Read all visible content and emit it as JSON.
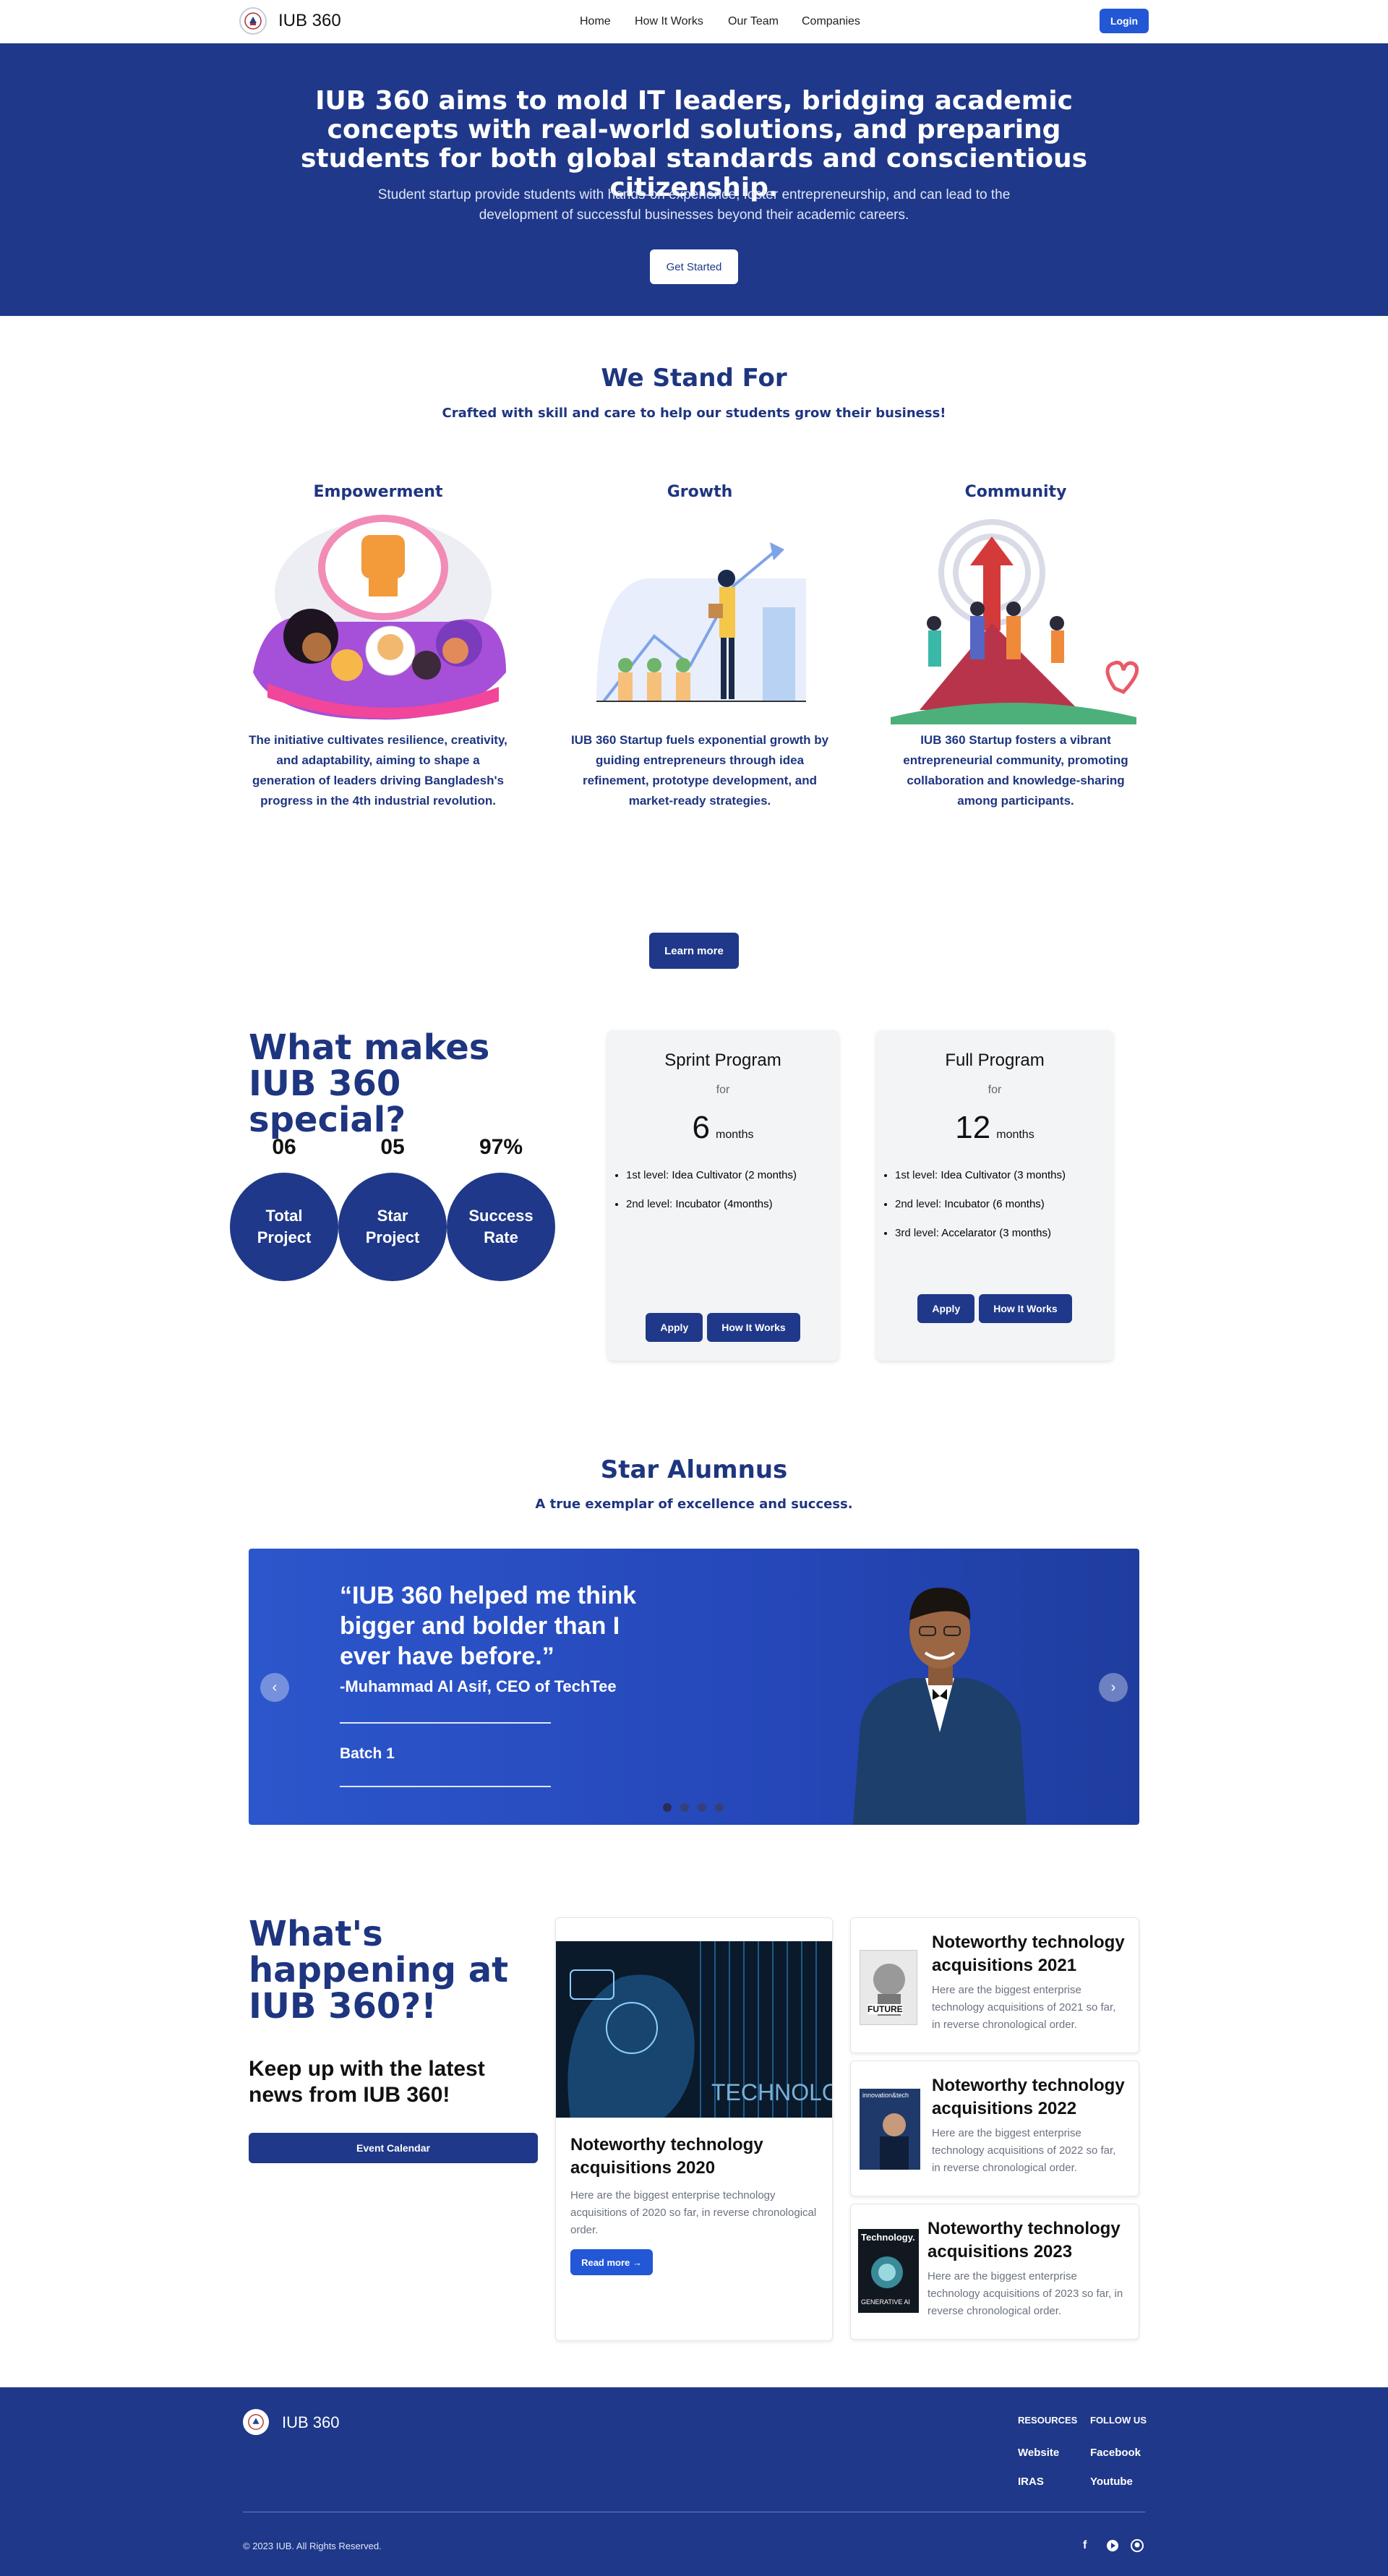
{
  "header": {
    "brand": "IUB 360",
    "nav": [
      "Home",
      "How It Works",
      "Our Team",
      "Companies"
    ],
    "login": "Login"
  },
  "hero": {
    "title": "IUB 360 aims to mold IT leaders, bridging academic concepts with real-world solutions, and preparing students for both global standards and conscientious citizenship.",
    "subtitle": "Student startup provide students with hands-on experience, foster entrepreneurship, and can lead to the development of successful businesses beyond their academic careers.",
    "cta": "Get Started"
  },
  "stand": {
    "title": "We Stand For",
    "subtitle": "Crafted with skill and care to help our students grow their business!",
    "pillars": [
      {
        "title": "Empowerment",
        "text": "The initiative cultivates resilience, creativity, and adaptability, aiming to shape a generation of leaders driving Bangladesh's progress in the 4th industrial revolution."
      },
      {
        "title": "Growth",
        "text": "IUB 360 Startup fuels exponential growth by guiding entrepreneurs through idea refinement, prototype development, and market-ready strategies."
      },
      {
        "title": "Community",
        "text": "IUB 360 Startup fosters a vibrant entrepreneurial community, promoting collaboration and knowledge-sharing among participants."
      }
    ],
    "learn_more": "Learn more"
  },
  "special": {
    "title": "What makes IUB 360 special?",
    "stats": [
      {
        "value": "06",
        "label": "Total Project"
      },
      {
        "value": "05",
        "label": "Star Project"
      },
      {
        "value": "97%",
        "label": "Success Rate"
      }
    ],
    "programs": [
      {
        "name": "Sprint Program",
        "for": "for",
        "months": "6",
        "unit": "months",
        "levels": [
          {
            "prefix": "1st level: ",
            "name": "Idea Cultivator (2 months)"
          },
          {
            "prefix": "2nd level: ",
            "name": "Incubator (4months)"
          }
        ],
        "apply": "Apply",
        "how": "How It Works"
      },
      {
        "name": "Full Program",
        "for": "for",
        "months": "12",
        "unit": "months",
        "levels": [
          {
            "prefix": "1st level: ",
            "name": "Idea Cultivator (3 months)"
          },
          {
            "prefix": "2nd level: ",
            "name": "Incubator (6 months)"
          },
          {
            "prefix": "3rd level: ",
            "name": "Accelarator (3 months)"
          }
        ],
        "apply": "Apply",
        "how": "How It Works"
      }
    ]
  },
  "alumni": {
    "title": "Star Alumnus",
    "subtitle": "A true exemplar of excellence and success.",
    "quote": "“IUB 360 helped me think bigger and bolder than I ever have before.”",
    "author": "-Muhammad Al Asif, CEO of TechTee",
    "batch": "Batch 1"
  },
  "news": {
    "title": "What's happening at IUB 360?!",
    "subtitle": "Keep up with the latest news from IUB 360!",
    "calendar": "Event Calendar",
    "featured": {
      "image_text": "TECHNOLOGY",
      "title": "Noteworthy technology acquisitions 2020",
      "text": "Here are the biggest enterprise technology acquisitions of 2020 so far, in reverse chronological order.",
      "read_more": "Read more"
    },
    "items": [
      {
        "cover": "FUTURE",
        "title": "Noteworthy technology acquisitions 2021",
        "text": "Here are the biggest enterprise technology acquisitions of 2021 so far, in reverse chronological order."
      },
      {
        "cover": "innovation&tech",
        "title": "Noteworthy technology acquisitions 2022",
        "text": "Here are the biggest enterprise technology acquisitions of 2022 so far, in reverse chronological order."
      },
      {
        "cover": "Technology.",
        "cover2": "GENERATIVE AI",
        "title": "Noteworthy technology acquisitions 2023",
        "text": "Here are the biggest enterprise technology acquisitions of 2023 so far, in reverse chronological order."
      }
    ]
  },
  "footer": {
    "brand": "IUB 360",
    "resources": "RESOURCES",
    "follow": "FOLLOW US",
    "links1": [
      "Website",
      "IRAS"
    ],
    "links2": [
      "Facebook",
      "Youtube"
    ],
    "copyright": "© 2023 IUB. All Rights Reserved.",
    "social": [
      "facebook-icon",
      "youtube-icon",
      "github-icon"
    ]
  },
  "colors": {
    "primary": "#1f3889",
    "accent": "#2257d6"
  }
}
